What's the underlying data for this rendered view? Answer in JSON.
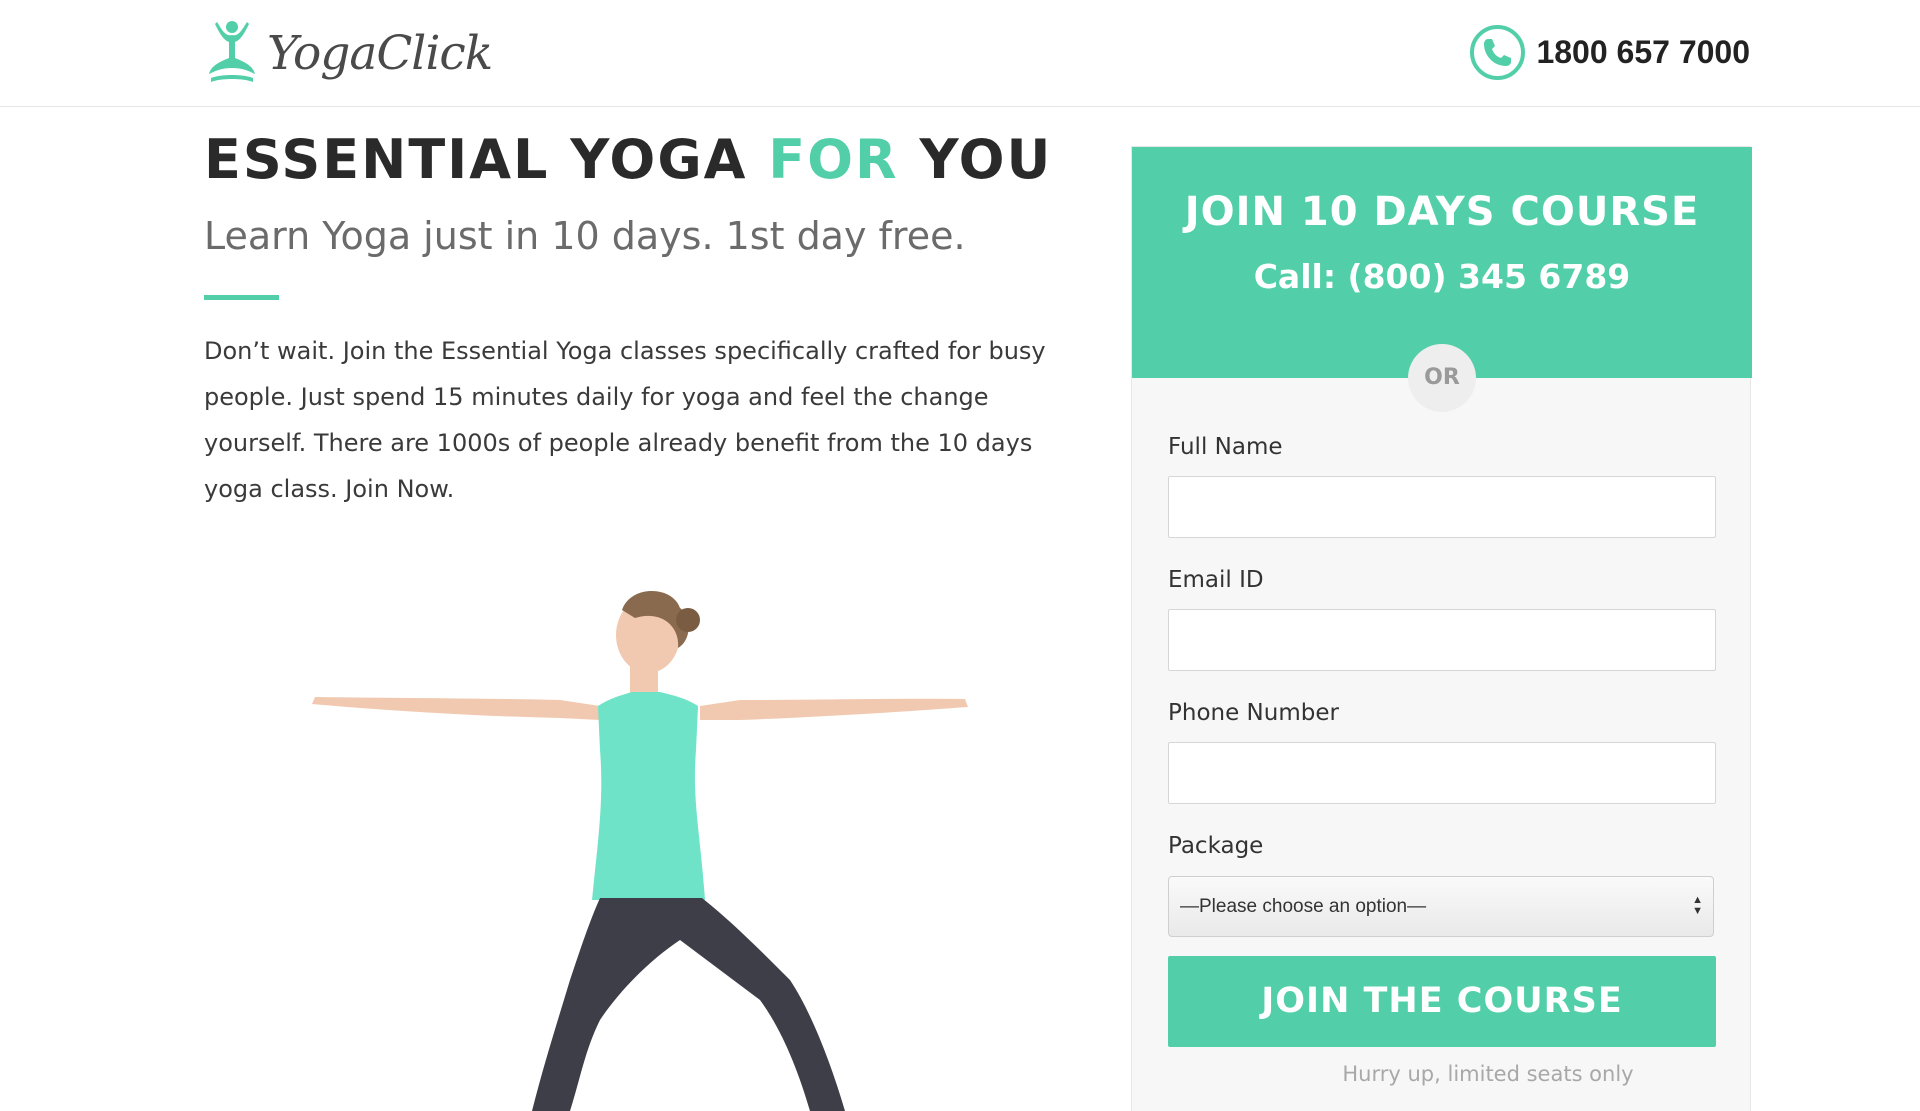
{
  "header": {
    "logo_text": "YogaClick",
    "phone_number": "1800 657 7000"
  },
  "hero": {
    "headline_part1": "ESSENTIAL YOGA ",
    "headline_accent": "FOR",
    "headline_part2": " YOU",
    "subheadline": "Learn Yoga just in 10 days. 1st day free.",
    "body": "Don’t wait. Join the Essential Yoga classes specifically crafted for busy people. Just spend 15 minutes daily for yoga and feel the change yourself. There are 1000s of people already benefit from the 10 days yoga class. Join Now."
  },
  "form": {
    "title": "JOIN 10 DAYS COURSE",
    "call_line": "Call: (800) 345 6789",
    "or_label": "OR",
    "full_name_label": "Full Name",
    "full_name_value": "",
    "email_label": "Email ID",
    "email_value": "",
    "phone_label": "Phone Number",
    "phone_value": "",
    "package_label": "Package",
    "package_selected": "—Please choose an option—",
    "submit_label": "JOIN THE COURSE",
    "note": "Hurry up, limited seats only"
  },
  "colors": {
    "accent": "#52cfa8",
    "headline": "#2a2a2a",
    "panel_bg": "#f7f7f7"
  },
  "icons": {
    "logo": "yoga-meditation-icon",
    "phone": "phone-icon",
    "select": "select-arrows-icon"
  }
}
